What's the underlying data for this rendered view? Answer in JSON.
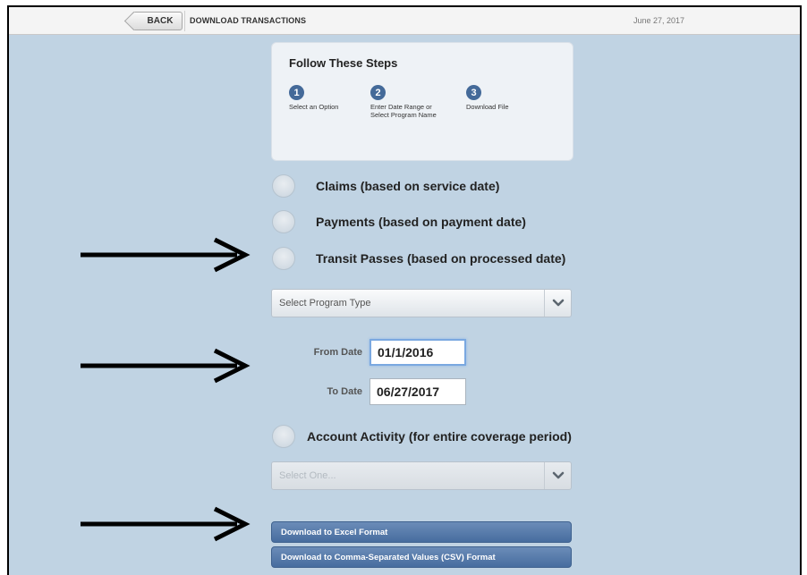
{
  "header": {
    "back_label": "BACK",
    "title": "DOWNLOAD TRANSACTIONS",
    "date": "June 27, 2017"
  },
  "steps": {
    "title": "Follow These Steps",
    "items": [
      {
        "num": "1",
        "text": "Select an Option"
      },
      {
        "num": "2",
        "text": "Enter Date Range or Select Program Name"
      },
      {
        "num": "3",
        "text": "Download File"
      }
    ]
  },
  "options": [
    {
      "label": "Claims (based on service date)"
    },
    {
      "label": "Payments (based on payment date)"
    },
    {
      "label": "Transit Passes (based on processed date)"
    }
  ],
  "program_select": {
    "value": "Select Program Type"
  },
  "dates": {
    "from_label": "From Date",
    "from_value": "01/1/2016",
    "to_label": "To Date",
    "to_value": "06/27/2017"
  },
  "account_activity": {
    "label": "Account Activity (for entire coverage period)",
    "select_value": "Select One..."
  },
  "downloads": {
    "excel_label": "Download to Excel Format",
    "csv_label": "Download to Comma-Separated Values (CSV) Format"
  },
  "icons": {
    "arrow": "right-arrow-icon",
    "dropdown": "chevron-down-icon"
  }
}
